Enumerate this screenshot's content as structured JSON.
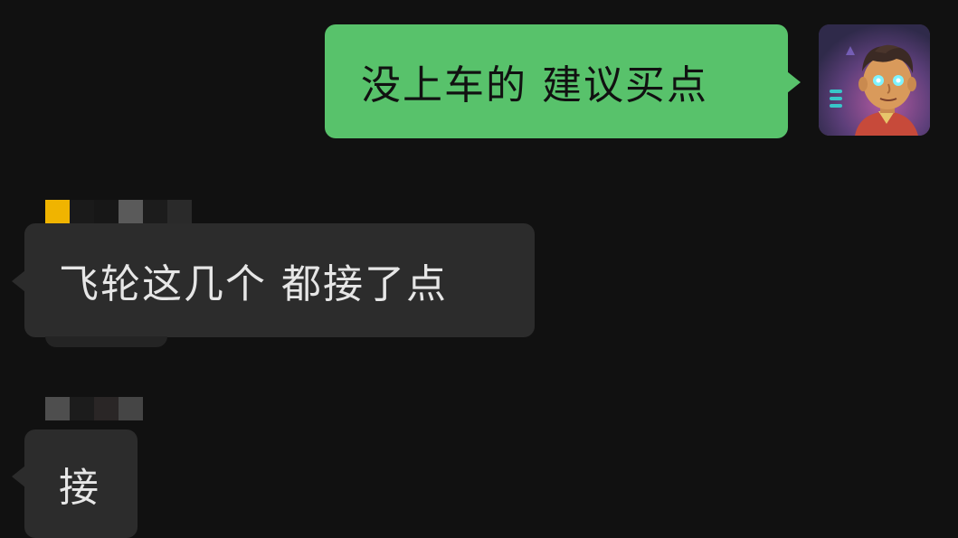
{
  "chat": {
    "outgoing": [
      {
        "text": "没上车的 建议买点",
        "bubble_color": "#58c26b"
      }
    ],
    "incoming": [
      {
        "text": "飞轮这几个 都接了点",
        "bubble_color": "#2c2c2c"
      },
      {
        "text": "接",
        "bubble_color": "#2c2c2c"
      }
    ],
    "avatar": {
      "icon": "cartoon-avatar-icon",
      "description_hidden": true
    },
    "background_color": "#111111",
    "sender_name_colors": [
      "#f0b400",
      "#5a5a5a",
      "#1a1a1a",
      "#2a2a2a"
    ]
  }
}
